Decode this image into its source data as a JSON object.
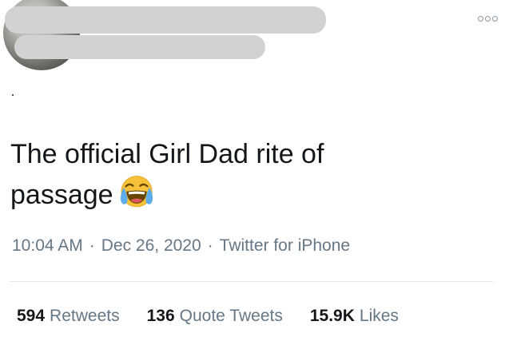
{
  "tweet": {
    "text": "The official Girl Dad rite of passage",
    "emoji": "face-with-tears-of-joy"
  },
  "meta": {
    "time": "10:04 AM",
    "separator": "·",
    "date": "Dec 26, 2020",
    "source": "Twitter for iPhone"
  },
  "stats": {
    "retweets_count": "594",
    "retweets_label": "Retweets",
    "quotes_count": "136",
    "quotes_label": "Quote Tweets",
    "likes_count": "15.9K",
    "likes_label": "Likes"
  },
  "colors": {
    "text": "#14171a",
    "muted": "#657786",
    "divider": "#e1e8ed",
    "redaction": "#d2d2d2"
  },
  "icons": {
    "more": "more-options-icon"
  }
}
